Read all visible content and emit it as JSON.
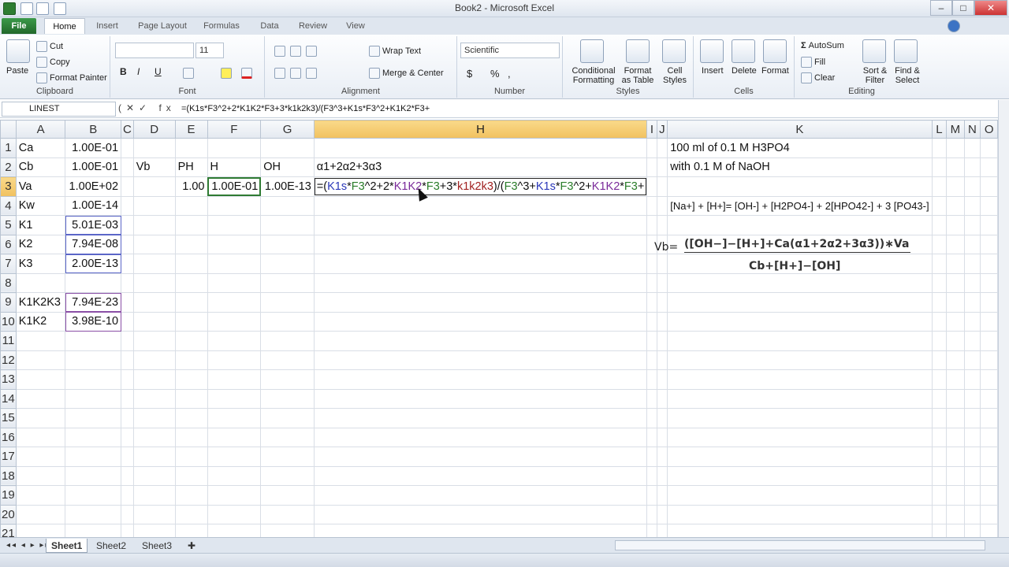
{
  "window": {
    "title": "Book2 - Microsoft Excel",
    "min": "–",
    "max": "□",
    "close": "✕"
  },
  "tabs": [
    "File",
    "Home",
    "Insert",
    "Page Layout",
    "Formulas",
    "Data",
    "Review",
    "View"
  ],
  "ribbon": {
    "clipboard": {
      "paste": "Paste",
      "cut": "Cut",
      "copy": "Copy",
      "format_painter": "Format Painter",
      "label": "Clipboard"
    },
    "font": {
      "font_size": "11",
      "label": "Font",
      "bold": "B",
      "italic": "I",
      "underline": "U"
    },
    "alignment": {
      "wrap": "Wrap Text",
      "merge": "Merge & Center",
      "label": "Alignment"
    },
    "number": {
      "format": "Scientific",
      "currency": "$",
      "percent": "%",
      "comma": ",",
      "label": "Number"
    },
    "styles": {
      "conditional": "Conditional Formatting",
      "format_table": "Format as Table",
      "cell_styles": "Cell Styles",
      "label": "Styles"
    },
    "cells": {
      "insert": "Insert",
      "delete": "Delete",
      "format": "Format",
      "label": "Cells"
    },
    "editing": {
      "autosum": "AutoSum",
      "fill": "Fill",
      "clear": "Clear",
      "sort": "Sort & Filter",
      "find": "Find & Select",
      "label": "Editing"
    }
  },
  "formula_bar": {
    "name_box": "LINEST",
    "buttons": "(✕✓ fx",
    "formula": "=(K1s*F3^2+2*K1K2*F3+3*k1k2k3)/(F3^3+K1s*F3^2+K1K2*F3+"
  },
  "columns": [
    "A",
    "B",
    "C",
    "D",
    "E",
    "F",
    "G",
    "H",
    "I",
    "J",
    "K",
    "L",
    "M",
    "N",
    "O"
  ],
  "rows": [
    "1",
    "2",
    "3",
    "4",
    "5",
    "6",
    "7",
    "8",
    "9",
    "10",
    "11",
    "12",
    "13",
    "14",
    "15",
    "16",
    "17",
    "18",
    "19",
    "20",
    "21"
  ],
  "cells": {
    "A1": "Ca",
    "B1": "1.00E-01",
    "K1": "100 ml of 0.1 M H3PO4",
    "A2": "Cb",
    "B2": "1.00E-01",
    "D2": "Vb",
    "E2": "PH",
    "F2": "H",
    "G2": "OH",
    "H2": "α1+2α2+3α3",
    "K2": "with 0.1 M of NaOH",
    "A3": "Va",
    "B3": "1.00E+02",
    "E3": "1.00",
    "F3": "1.00E-01",
    "G3": "1.00E-13",
    "A4": "Kw",
    "B4": "1.00E-14",
    "K4": "[Na+] + [H+]= [OH-] + [H2PO4-] + 2[HPO42-] + 3 [PO43-]",
    "A5": "K1",
    "B5": "5.01E-03",
    "A6": "K2",
    "B6": "7.94E-08",
    "A7": "K3",
    "B7": "2.00E-13",
    "A9": "K1K2K3",
    "B9": "7.94E-23",
    "A10": "K1K2",
    "B10": "3.98E-10"
  },
  "h3_formula": {
    "p1": "=(",
    "p2": "K1s",
    "p3": "*",
    "p4": "F3",
    "p5": "^2+2*",
    "p6": "K1K2",
    "p7": "*",
    "p8": "F3",
    "p9": "+3*",
    "p10": "k1k2k3",
    "p11": ")/(",
    "p12": "F3",
    "p13": "^3+",
    "p14": "K1s",
    "p15": "*",
    "p16": "F3",
    "p17": "^2+",
    "p18": "K1K2",
    "p19": "*",
    "p20": "F3",
    "p21": "+"
  },
  "equation": {
    "label": "Vb=",
    "numerator": "([OH−]−[H+]+Ca(α1+2α2+3α3))∗Va",
    "denominator": "Cb+[H+]−[OH]"
  },
  "sheets": [
    "Sheet1",
    "Sheet2",
    "Sheet3"
  ],
  "status": {
    "mode": ""
  }
}
